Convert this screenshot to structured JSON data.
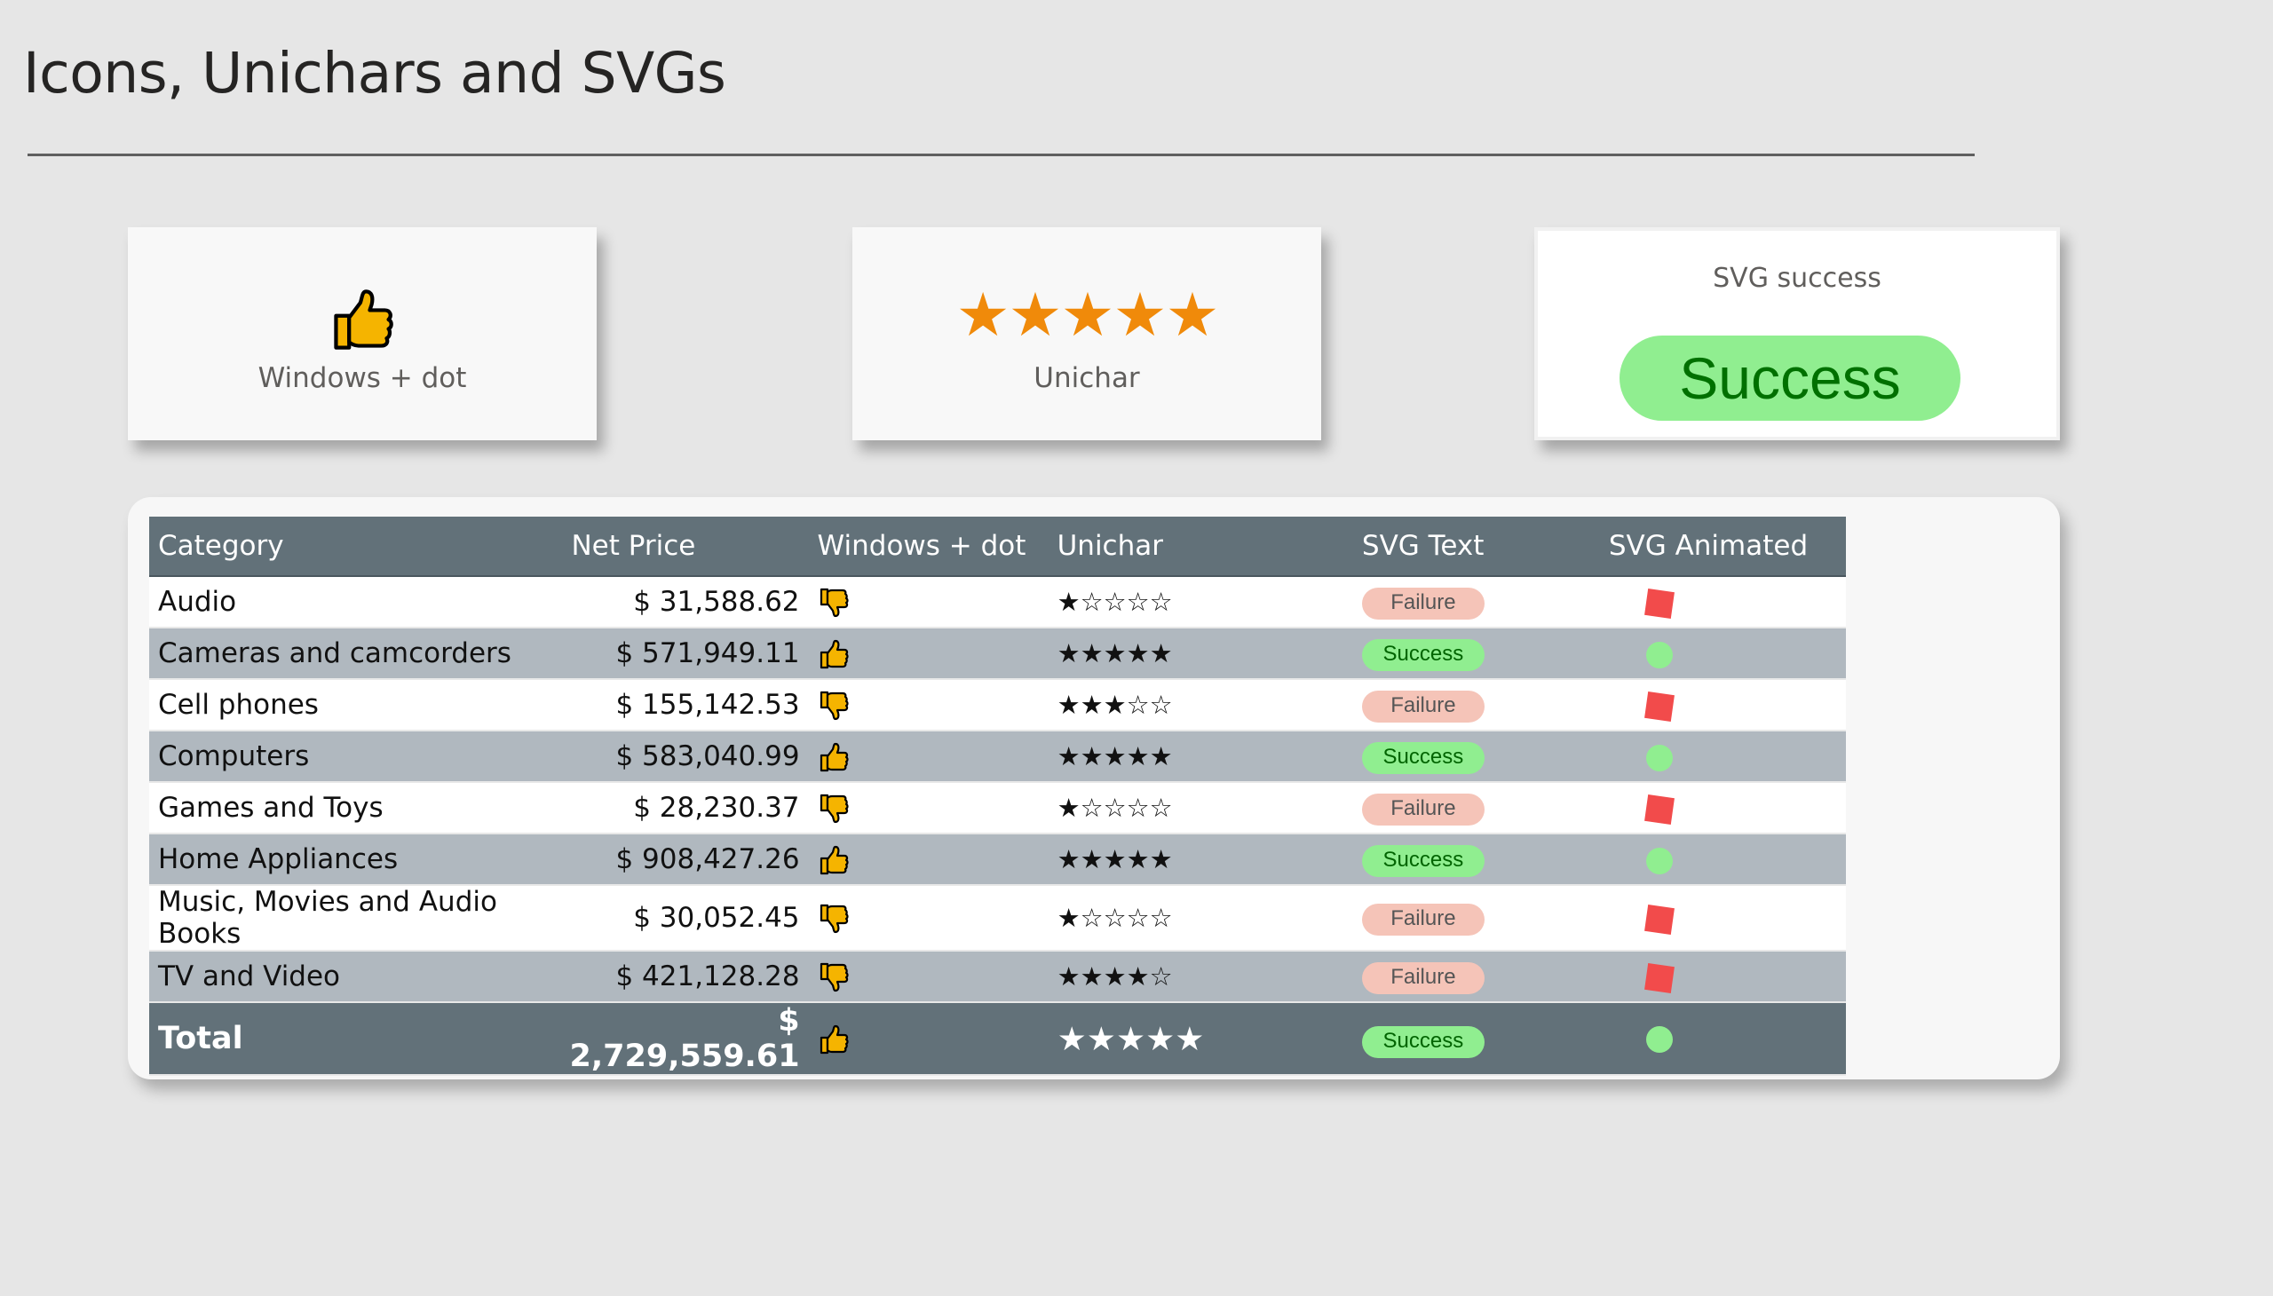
{
  "page": {
    "title": "Icons, Unichars and SVGs"
  },
  "cards": {
    "windows_dot": {
      "label": "Windows + dot",
      "icon": "thumbs-up-icon"
    },
    "unichar": {
      "label": "Unichar",
      "stars": "★★★★★"
    },
    "svg": {
      "label": "SVG success",
      "badge": "Success"
    }
  },
  "colors": {
    "background": "#e6e6e6",
    "header": "#627179",
    "band": "#b0b8bf",
    "star_orange": "#f08a0a",
    "success_fill": "#90ee90",
    "success_text": "#007000",
    "failure_fill": "#f5c4b8",
    "animated_red": "#f24b4b"
  },
  "table": {
    "headers": {
      "category": "Category",
      "net_price": "Net Price",
      "windows_dot": "Windows + dot",
      "unichar": "Unichar",
      "svg_text": "SVG Text",
      "svg_animated": "SVG Animated"
    },
    "rows": [
      {
        "category": "Audio",
        "price": "$ 31,588.62",
        "thumb": "thumbs-down",
        "stars": "★☆☆☆☆",
        "status": "Failure",
        "anim": "red-square"
      },
      {
        "category": "Cameras and camcorders",
        "price": "$ 571,949.11",
        "thumb": "thumbs-up",
        "stars": "★★★★★",
        "status": "Success",
        "anim": "green-dot"
      },
      {
        "category": "Cell phones",
        "price": "$ 155,142.53",
        "thumb": "thumbs-down",
        "stars": "★★★☆☆",
        "status": "Failure",
        "anim": "red-square"
      },
      {
        "category": "Computers",
        "price": "$ 583,040.99",
        "thumb": "thumbs-up",
        "stars": "★★★★★",
        "status": "Success",
        "anim": "green-dot"
      },
      {
        "category": "Games and Toys",
        "price": "$ 28,230.37",
        "thumb": "thumbs-down",
        "stars": "★☆☆☆☆",
        "status": "Failure",
        "anim": "red-square"
      },
      {
        "category": "Home Appliances",
        "price": "$ 908,427.26",
        "thumb": "thumbs-up",
        "stars": "★★★★★",
        "status": "Success",
        "anim": "green-dot"
      },
      {
        "category": "Music, Movies and Audio Books",
        "price": "$ 30,052.45",
        "thumb": "thumbs-down",
        "stars": "★☆☆☆☆",
        "status": "Failure",
        "anim": "red-square"
      },
      {
        "category": "TV and Video",
        "price": "$ 421,128.28",
        "thumb": "thumbs-down",
        "stars": "★★★★☆",
        "status": "Failure",
        "anim": "red-square"
      }
    ],
    "total": {
      "category": "Total",
      "price": "$ 2,729,559.61",
      "thumb": "thumbs-up",
      "stars": "★★★★★",
      "status": "Success",
      "anim": "green-dot"
    }
  }
}
